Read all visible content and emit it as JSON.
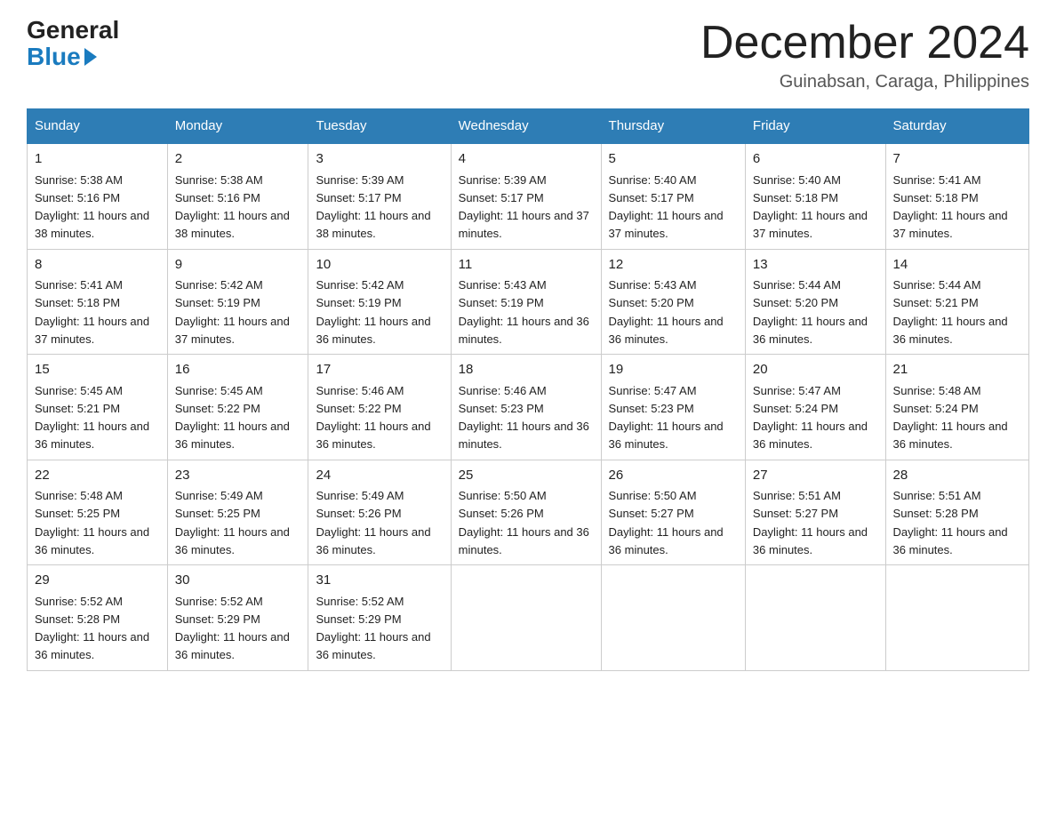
{
  "header": {
    "logo": {
      "general": "General",
      "blue": "Blue"
    },
    "title": "December 2024",
    "location": "Guinabsan, Caraga, Philippines"
  },
  "days_of_week": [
    "Sunday",
    "Monday",
    "Tuesday",
    "Wednesday",
    "Thursday",
    "Friday",
    "Saturday"
  ],
  "weeks": [
    [
      {
        "day": "1",
        "sunrise": "5:38 AM",
        "sunset": "5:16 PM",
        "daylight": "11 hours and 38 minutes."
      },
      {
        "day": "2",
        "sunrise": "5:38 AM",
        "sunset": "5:16 PM",
        "daylight": "11 hours and 38 minutes."
      },
      {
        "day": "3",
        "sunrise": "5:39 AM",
        "sunset": "5:17 PM",
        "daylight": "11 hours and 38 minutes."
      },
      {
        "day": "4",
        "sunrise": "5:39 AM",
        "sunset": "5:17 PM",
        "daylight": "11 hours and 37 minutes."
      },
      {
        "day": "5",
        "sunrise": "5:40 AM",
        "sunset": "5:17 PM",
        "daylight": "11 hours and 37 minutes."
      },
      {
        "day": "6",
        "sunrise": "5:40 AM",
        "sunset": "5:18 PM",
        "daylight": "11 hours and 37 minutes."
      },
      {
        "day": "7",
        "sunrise": "5:41 AM",
        "sunset": "5:18 PM",
        "daylight": "11 hours and 37 minutes."
      }
    ],
    [
      {
        "day": "8",
        "sunrise": "5:41 AM",
        "sunset": "5:18 PM",
        "daylight": "11 hours and 37 minutes."
      },
      {
        "day": "9",
        "sunrise": "5:42 AM",
        "sunset": "5:19 PM",
        "daylight": "11 hours and 37 minutes."
      },
      {
        "day": "10",
        "sunrise": "5:42 AM",
        "sunset": "5:19 PM",
        "daylight": "11 hours and 36 minutes."
      },
      {
        "day": "11",
        "sunrise": "5:43 AM",
        "sunset": "5:19 PM",
        "daylight": "11 hours and 36 minutes."
      },
      {
        "day": "12",
        "sunrise": "5:43 AM",
        "sunset": "5:20 PM",
        "daylight": "11 hours and 36 minutes."
      },
      {
        "day": "13",
        "sunrise": "5:44 AM",
        "sunset": "5:20 PM",
        "daylight": "11 hours and 36 minutes."
      },
      {
        "day": "14",
        "sunrise": "5:44 AM",
        "sunset": "5:21 PM",
        "daylight": "11 hours and 36 minutes."
      }
    ],
    [
      {
        "day": "15",
        "sunrise": "5:45 AM",
        "sunset": "5:21 PM",
        "daylight": "11 hours and 36 minutes."
      },
      {
        "day": "16",
        "sunrise": "5:45 AM",
        "sunset": "5:22 PM",
        "daylight": "11 hours and 36 minutes."
      },
      {
        "day": "17",
        "sunrise": "5:46 AM",
        "sunset": "5:22 PM",
        "daylight": "11 hours and 36 minutes."
      },
      {
        "day": "18",
        "sunrise": "5:46 AM",
        "sunset": "5:23 PM",
        "daylight": "11 hours and 36 minutes."
      },
      {
        "day": "19",
        "sunrise": "5:47 AM",
        "sunset": "5:23 PM",
        "daylight": "11 hours and 36 minutes."
      },
      {
        "day": "20",
        "sunrise": "5:47 AM",
        "sunset": "5:24 PM",
        "daylight": "11 hours and 36 minutes."
      },
      {
        "day": "21",
        "sunrise": "5:48 AM",
        "sunset": "5:24 PM",
        "daylight": "11 hours and 36 minutes."
      }
    ],
    [
      {
        "day": "22",
        "sunrise": "5:48 AM",
        "sunset": "5:25 PM",
        "daylight": "11 hours and 36 minutes."
      },
      {
        "day": "23",
        "sunrise": "5:49 AM",
        "sunset": "5:25 PM",
        "daylight": "11 hours and 36 minutes."
      },
      {
        "day": "24",
        "sunrise": "5:49 AM",
        "sunset": "5:26 PM",
        "daylight": "11 hours and 36 minutes."
      },
      {
        "day": "25",
        "sunrise": "5:50 AM",
        "sunset": "5:26 PM",
        "daylight": "11 hours and 36 minutes."
      },
      {
        "day": "26",
        "sunrise": "5:50 AM",
        "sunset": "5:27 PM",
        "daylight": "11 hours and 36 minutes."
      },
      {
        "day": "27",
        "sunrise": "5:51 AM",
        "sunset": "5:27 PM",
        "daylight": "11 hours and 36 minutes."
      },
      {
        "day": "28",
        "sunrise": "5:51 AM",
        "sunset": "5:28 PM",
        "daylight": "11 hours and 36 minutes."
      }
    ],
    [
      {
        "day": "29",
        "sunrise": "5:52 AM",
        "sunset": "5:28 PM",
        "daylight": "11 hours and 36 minutes."
      },
      {
        "day": "30",
        "sunrise": "5:52 AM",
        "sunset": "5:29 PM",
        "daylight": "11 hours and 36 minutes."
      },
      {
        "day": "31",
        "sunrise": "5:52 AM",
        "sunset": "5:29 PM",
        "daylight": "11 hours and 36 minutes."
      },
      null,
      null,
      null,
      null
    ]
  ]
}
